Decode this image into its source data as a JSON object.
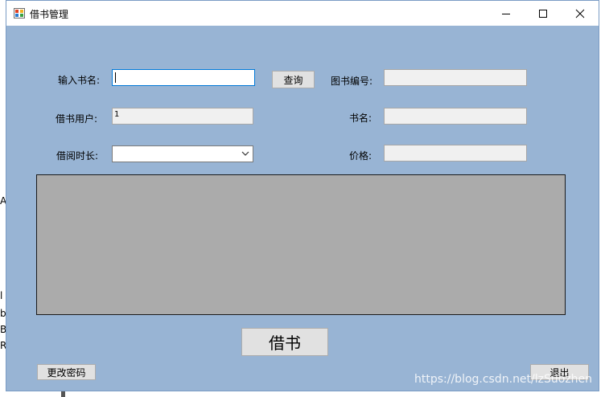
{
  "background": {
    "fragments": [
      "A",
      "l",
      "b",
      "B",
      "R"
    ]
  },
  "window": {
    "title": "借书管理",
    "colors": {
      "client_bg": "#98b4d4",
      "grid_bg": "#ababab",
      "focus_border": "#0078d7"
    }
  },
  "form": {
    "book_name_label": "输入书名:",
    "book_name_value": "",
    "search_button": "查询",
    "book_number_label": "图书编号:",
    "book_number_value": "",
    "user_label": "借书用户:",
    "user_value": "1",
    "title_label": "书名:",
    "title_value": "",
    "duration_label": "借阅时长:",
    "duration_selected": "",
    "price_label": "价格:",
    "price_value": ""
  },
  "actions": {
    "borrow": "借书",
    "change_password": "更改密码",
    "exit": "退出"
  },
  "watermark": "https://blog.csdn.net/lzSuozhen"
}
